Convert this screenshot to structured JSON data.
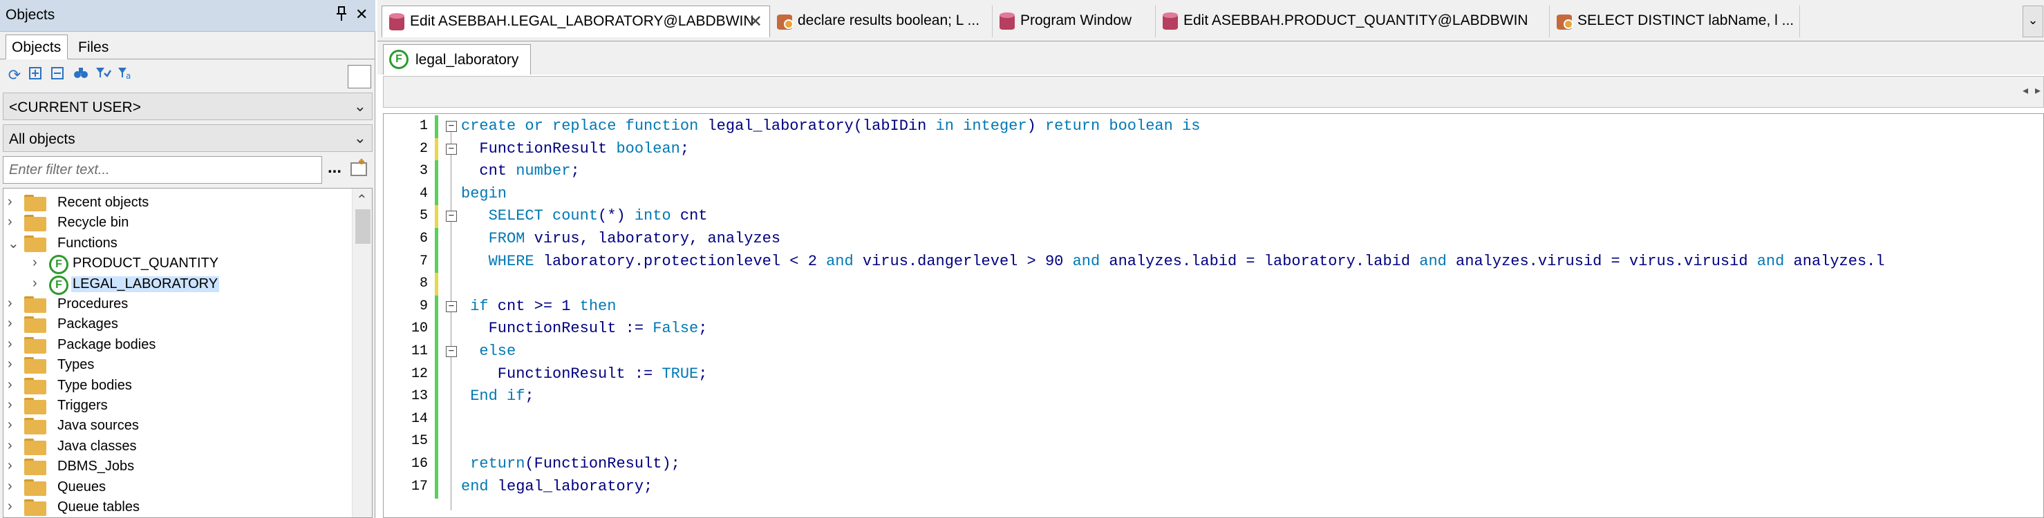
{
  "objects_panel": {
    "title": "Objects",
    "tabs": [
      "Objects",
      "Files"
    ],
    "user_combo": "<CURRENT USER>",
    "scope_combo": "All objects",
    "filter_placeholder": "Enter filter text...",
    "more_label": "...",
    "tree": [
      {
        "label": "Recent objects",
        "type": "folder",
        "expanded": false
      },
      {
        "label": "Recycle bin",
        "type": "folder",
        "expanded": false
      },
      {
        "label": "Functions",
        "type": "folder",
        "expanded": true
      },
      {
        "label": "PRODUCT_QUANTITY",
        "type": "function",
        "child": true
      },
      {
        "label": "LEGAL_LABORATORY",
        "type": "function",
        "child": true,
        "selected": true
      },
      {
        "label": "Procedures",
        "type": "folder"
      },
      {
        "label": "Packages",
        "type": "folder"
      },
      {
        "label": "Package bodies",
        "type": "folder"
      },
      {
        "label": "Types",
        "type": "folder"
      },
      {
        "label": "Type bodies",
        "type": "folder"
      },
      {
        "label": "Triggers",
        "type": "folder"
      },
      {
        "label": "Java sources",
        "type": "folder"
      },
      {
        "label": "Java classes",
        "type": "folder"
      },
      {
        "label": "DBMS_Jobs",
        "type": "folder"
      },
      {
        "label": "Queues",
        "type": "folder"
      },
      {
        "label": "Queue tables",
        "type": "folder"
      }
    ]
  },
  "doc_tabs": [
    {
      "label": "Edit ASEBBAH.LEGAL_LABORATORY@LABDBWIN",
      "active": true
    },
    {
      "label": "declare results boolean; L ..."
    },
    {
      "label": "Program Window"
    },
    {
      "label": "Edit ASEBBAH.PRODUCT_QUANTITY@LABDBWIN"
    },
    {
      "label": "SELECT DISTINCT labName, l ..."
    }
  ],
  "sub_tab": "legal_laboratory",
  "icons": {
    "refresh": "refresh-icon",
    "expand": "expand-all-icon",
    "collapse": "collapse-all-icon",
    "find": "find-icon",
    "filter": "filter-icon",
    "sort": "sort-icon"
  },
  "code_lines": [
    "create or replace function legal_laboratory(labIDin in integer) return boolean is",
    "  FunctionResult boolean;",
    "  cnt number;",
    "begin",
    "   SELECT count(*) into cnt",
    "   FROM virus, laboratory, analyzes",
    "   WHERE laboratory.protectionlevel < 2 and virus.dangerlevel > 90 and analyzes.labid = laboratory.labid and analyzes.virusid = virus.virusid and analyzes.l",
    "",
    " if cnt >= 1 then",
    "   FunctionResult := False;",
    "  else",
    "    FunctionResult := TRUE;",
    " End if;",
    "",
    "",
    " return(FunctionResult);",
    "end legal_laboratory;"
  ],
  "colors": {
    "keyword": "#0078b4",
    "identifier": "#000080",
    "panel_header": "#cfdbe9",
    "selected": "#cce4ff"
  }
}
